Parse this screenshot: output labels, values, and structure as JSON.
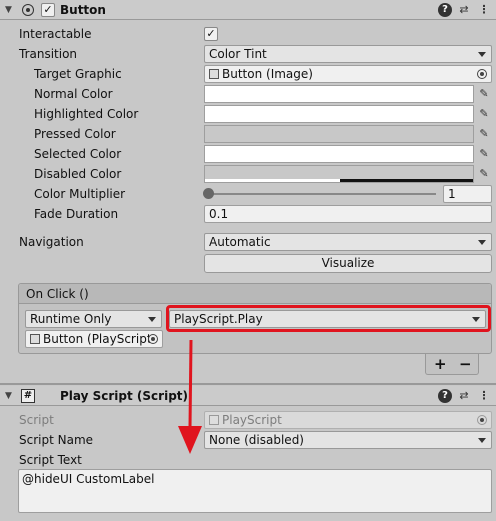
{
  "button_component": {
    "title": "Button",
    "rows": {
      "interactable": "Interactable",
      "transition": "Transition",
      "transition_value": "Color Tint",
      "target_graphic": "Target Graphic",
      "target_graphic_value": "Button (Image)",
      "normal_color": "Normal Color",
      "highlighted_color": "Highlighted Color",
      "pressed_color": "Pressed Color",
      "selected_color": "Selected Color",
      "disabled_color": "Disabled Color",
      "color_multiplier": "Color Multiplier",
      "color_multiplier_value": "1",
      "fade_duration": "Fade Duration",
      "fade_duration_value": "0.1",
      "navigation": "Navigation",
      "navigation_value": "Automatic",
      "visualize": "Visualize"
    },
    "interactable_checked": true,
    "color_multiplier_level": 0.0
  },
  "on_click": {
    "header": "On Click ()",
    "runtime": "Runtime Only",
    "function": "PlayScript.Play",
    "object": "Button (PlayScript",
    "add": "+",
    "remove": "−"
  },
  "play_script": {
    "title": "Play Script (Script)",
    "script_label": "Script",
    "script_value": "PlayScript",
    "script_name_label": "Script Name",
    "script_name_value": "None (disabled)",
    "script_text_label": "Script Text",
    "script_text_value": "@hideUI CustomLabel"
  },
  "colors": {
    "highlight_red": "#e0141e",
    "arrow_red": "#e0141e"
  },
  "icons": {
    "help": "?",
    "settings": "⇄",
    "menu": "⋮",
    "foldout": "▼",
    "picker": "✎",
    "script": "#"
  }
}
